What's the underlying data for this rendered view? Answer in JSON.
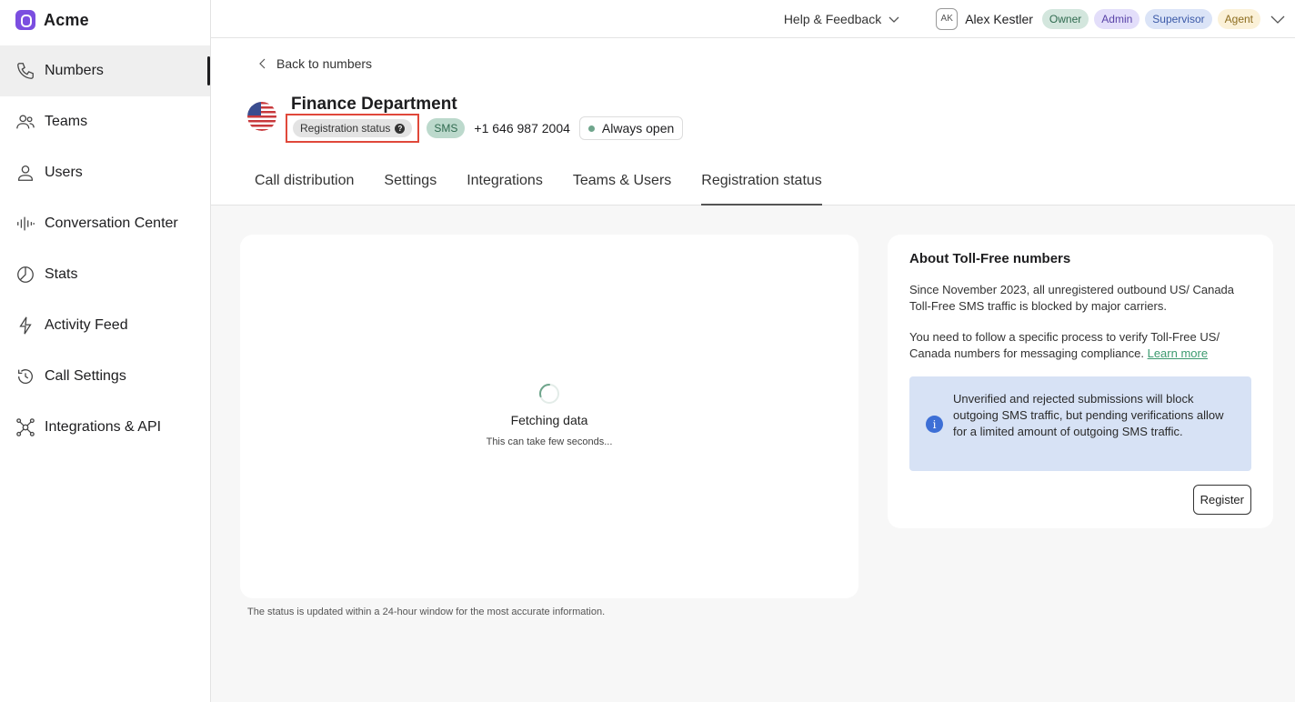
{
  "brand": {
    "name": "Acme"
  },
  "sidebar": {
    "items": [
      {
        "label": "Numbers",
        "icon": "phone-icon",
        "active": true
      },
      {
        "label": "Teams",
        "icon": "teams-icon"
      },
      {
        "label": "Users",
        "icon": "user-icon"
      },
      {
        "label": "Conversation Center",
        "icon": "waveform-icon"
      },
      {
        "label": "Stats",
        "icon": "pie-chart-icon"
      },
      {
        "label": "Activity Feed",
        "icon": "bolt-icon"
      },
      {
        "label": "Call Settings",
        "icon": "clock-settings-icon"
      },
      {
        "label": "Integrations & API",
        "icon": "network-icon"
      }
    ]
  },
  "header": {
    "help_label": "Help & Feedback",
    "user": {
      "initials": "AK",
      "name": "Alex Kestler"
    },
    "roles": [
      "Owner",
      "Admin",
      "Supervisor",
      "Agent"
    ]
  },
  "page": {
    "back_label": "Back to numbers",
    "title": "Finance Department",
    "registration_chip": "Registration status",
    "sms_chip": "SMS",
    "phone": "+1 646 987 2004",
    "availability": "Always open",
    "tabs": [
      "Call distribution",
      "Settings",
      "Integrations",
      "Teams & Users",
      "Registration status"
    ],
    "active_tab": "Registration status"
  },
  "fetch": {
    "title": "Fetching data",
    "subtitle": "This can take few seconds...",
    "footnote": "The status is updated within a 24-hour window for the most accurate information."
  },
  "about": {
    "title": "About Toll-Free numbers",
    "p1": "Since November 2023, all unregistered outbound US/ Canada Toll-Free SMS traffic is blocked by major carriers.",
    "p2": "You need to follow a specific process to verify Toll-Free US/ Canada numbers for messaging compliance.",
    "learn_more": "Learn more",
    "info": "Unverified and rejected submissions will block outgoing SMS traffic, but pending verifications allow for a limited amount of outgoing SMS traffic.",
    "register_label": "Register"
  },
  "colors": {
    "accent": "#7b4ee0",
    "highlight_border": "#e0483a",
    "link": "#3c9a6f",
    "info_bg": "#d7e2f5"
  }
}
